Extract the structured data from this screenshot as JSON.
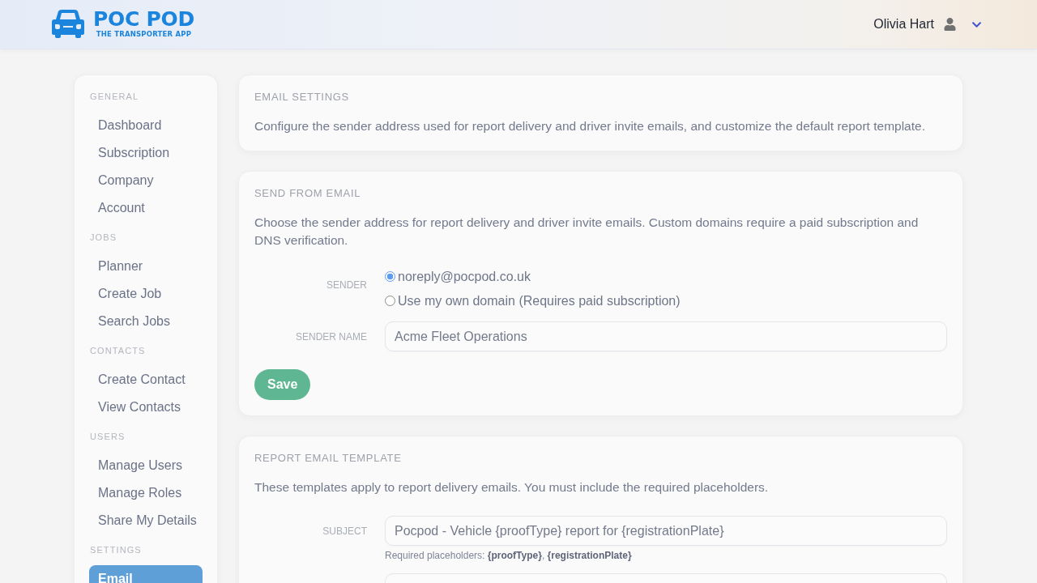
{
  "header": {
    "logo": {
      "title": "POC POD",
      "tagline": "THE TRANSPORTER APP"
    },
    "user": {
      "name": "Olivia Hart"
    }
  },
  "sidebar": {
    "sections": [
      {
        "title": "GENERAL",
        "items": [
          {
            "label": "Dashboard",
            "selected": false
          },
          {
            "label": "Subscription",
            "selected": false
          },
          {
            "label": "Company",
            "selected": false
          },
          {
            "label": "Account",
            "selected": false
          }
        ]
      },
      {
        "title": "JOBS",
        "items": [
          {
            "label": "Planner",
            "selected": false
          },
          {
            "label": "Create Job",
            "selected": false
          },
          {
            "label": "Search Jobs",
            "selected": false
          }
        ]
      },
      {
        "title": "CONTACTS",
        "items": [
          {
            "label": "Create Contact",
            "selected": false
          },
          {
            "label": "View Contacts",
            "selected": false
          }
        ]
      },
      {
        "title": "USERS",
        "items": [
          {
            "label": "Manage Users",
            "selected": false
          },
          {
            "label": "Manage Roles",
            "selected": false
          },
          {
            "label": "Share My Details",
            "selected": false
          }
        ]
      },
      {
        "title": "SETTINGS",
        "items": [
          {
            "label": "Email",
            "selected": true
          }
        ]
      }
    ]
  },
  "email_settings": {
    "title": "EMAIL SETTINGS",
    "description": "Configure the sender address used for report delivery and driver invite emails, and customize the default report template."
  },
  "send_from_email": {
    "title": "SEND FROM EMAIL",
    "description": "Choose the sender address for report delivery and driver invite emails. Custom domains require a paid subscription and DNS verification.",
    "sender": {
      "label": "SENDER",
      "options": [
        {
          "label": "noreply@pocpod.co.uk",
          "selected": true
        },
        {
          "label": "Use my own domain (Requires paid subscription)",
          "selected": false
        }
      ]
    },
    "sender_name": {
      "label": "SENDER NAME",
      "value": "Acme Fleet Operations"
    },
    "save_button": {
      "label": "Save",
      "disabled": true
    }
  },
  "report_email_template": {
    "title": "REPORT EMAIL TEMPLATE",
    "description": "These templates apply to report delivery emails. You must include the required placeholders.",
    "subject": {
      "label": "SUBJECT",
      "value": "Pocpod - Vehicle {proofType} report for {registrationPlate}",
      "help": "Required placeholders: **{proofType}**, **{registrationPlate}**"
    }
  }
}
